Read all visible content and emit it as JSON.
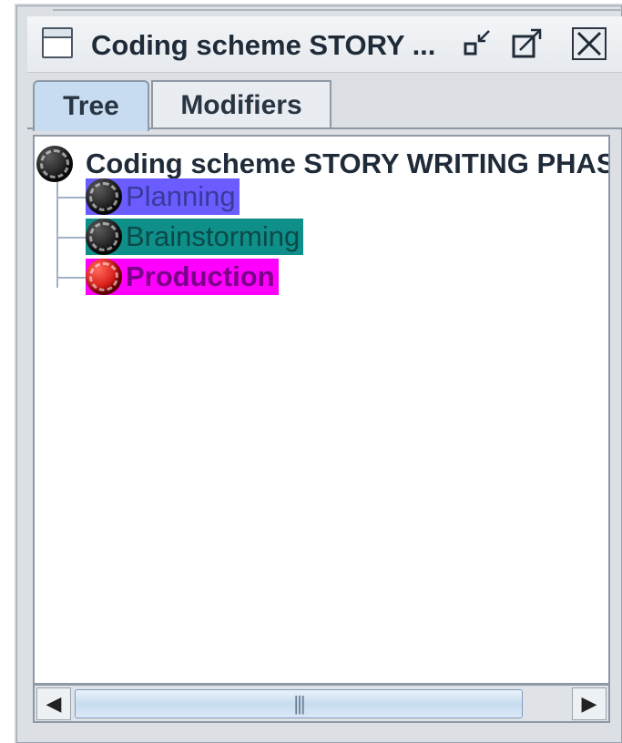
{
  "window": {
    "title": "Coding scheme STORY ...",
    "icon": "window-icon",
    "controls": [
      "minimize-icon",
      "maximize-icon",
      "close-icon"
    ]
  },
  "tabs": [
    {
      "label": "Tree",
      "selected": true
    },
    {
      "label": "Modifiers",
      "selected": false
    }
  ],
  "tree": {
    "root": {
      "label": "Coding scheme STORY WRITING PHAS",
      "icon": "black-ball-icon"
    },
    "children": [
      {
        "label": "Planning",
        "icon": "black-ball-icon",
        "bg": "#6b5cff",
        "fg": "#3a3a9a"
      },
      {
        "label": "Brainstorming",
        "icon": "black-ball-icon",
        "bg": "#0f8f8a",
        "fg": "#0b4a48"
      },
      {
        "label": "Production",
        "icon": "red-ball-icon",
        "bg": "#ff00ff",
        "fg": "#7a0088"
      }
    ]
  },
  "scrollbar": {
    "left_arrow": "◀",
    "right_arrow": "▶",
    "thumb_grip": "|||"
  }
}
